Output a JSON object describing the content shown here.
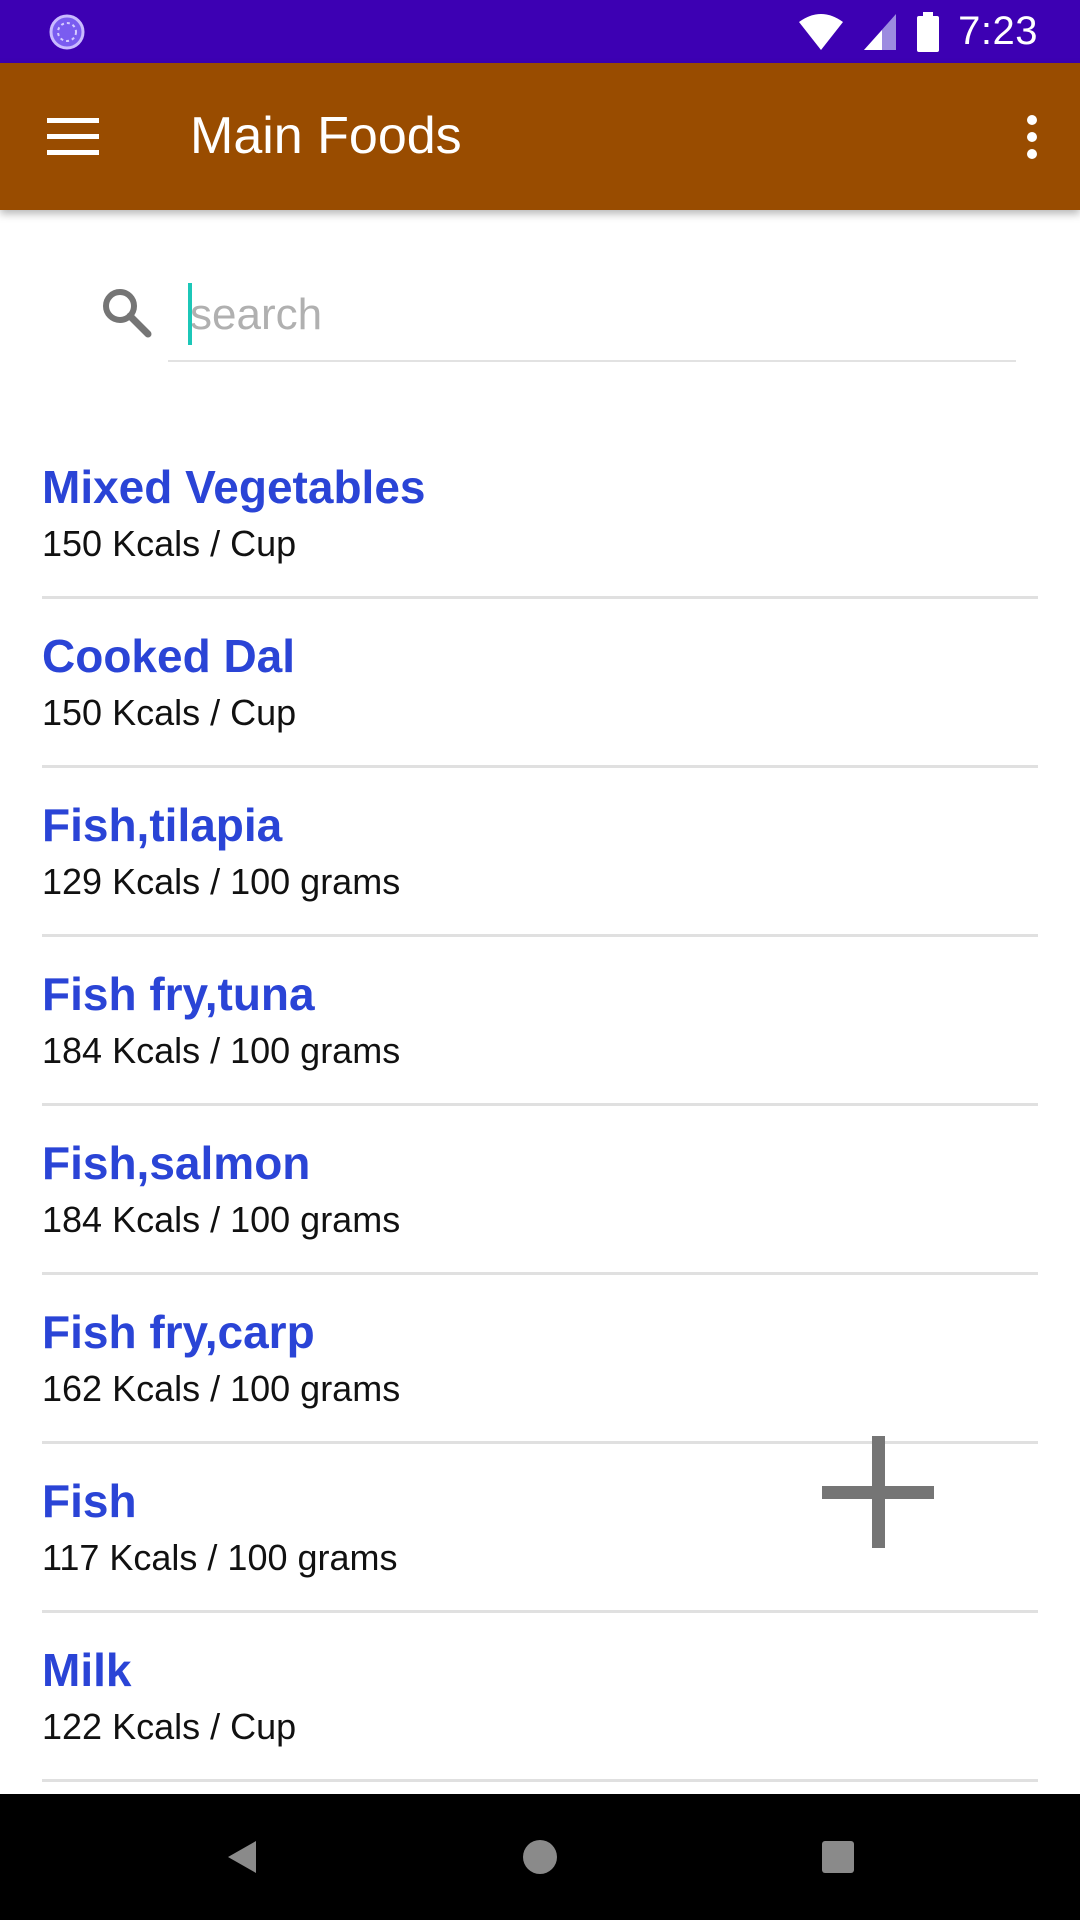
{
  "status_bar": {
    "time": "7:23",
    "left_icon": "loading-circle-icon",
    "right_icons": [
      "wifi-icon",
      "signal-icon",
      "battery-icon"
    ],
    "background_color": "#3d00b3"
  },
  "app_bar": {
    "title": "Main Foods",
    "menu_icon": "hamburger-menu-icon",
    "overflow_icon": "more-vert-icon",
    "background_color": "#994c00"
  },
  "search": {
    "placeholder": "search",
    "value": "",
    "icon": "search-icon"
  },
  "food_list": {
    "items": [
      {
        "name": "Mixed Vegetables",
        "kcal": "150 Kcals / Cup"
      },
      {
        "name": "Cooked Dal",
        "kcal": "150 Kcals / Cup"
      },
      {
        "name": "Fish,tilapia",
        "kcal": "129 Kcals / 100 grams"
      },
      {
        "name": "Fish fry,tuna",
        "kcal": "184 Kcals / 100 grams"
      },
      {
        "name": "Fish,salmon",
        "kcal": "184 Kcals / 100 grams"
      },
      {
        "name": "Fish fry,carp",
        "kcal": "162 Kcals / 100 grams"
      },
      {
        "name": "Fish",
        "kcal": "117 Kcals / 100 grams"
      },
      {
        "name": "Milk",
        "kcal": "122 Kcals / Cup"
      }
    ],
    "name_color": "#2a44d6"
  },
  "add_button": {
    "icon": "plus-icon",
    "color": "#757575"
  },
  "nav_bar": {
    "buttons": [
      "back-icon",
      "home-icon",
      "recents-icon"
    ]
  }
}
